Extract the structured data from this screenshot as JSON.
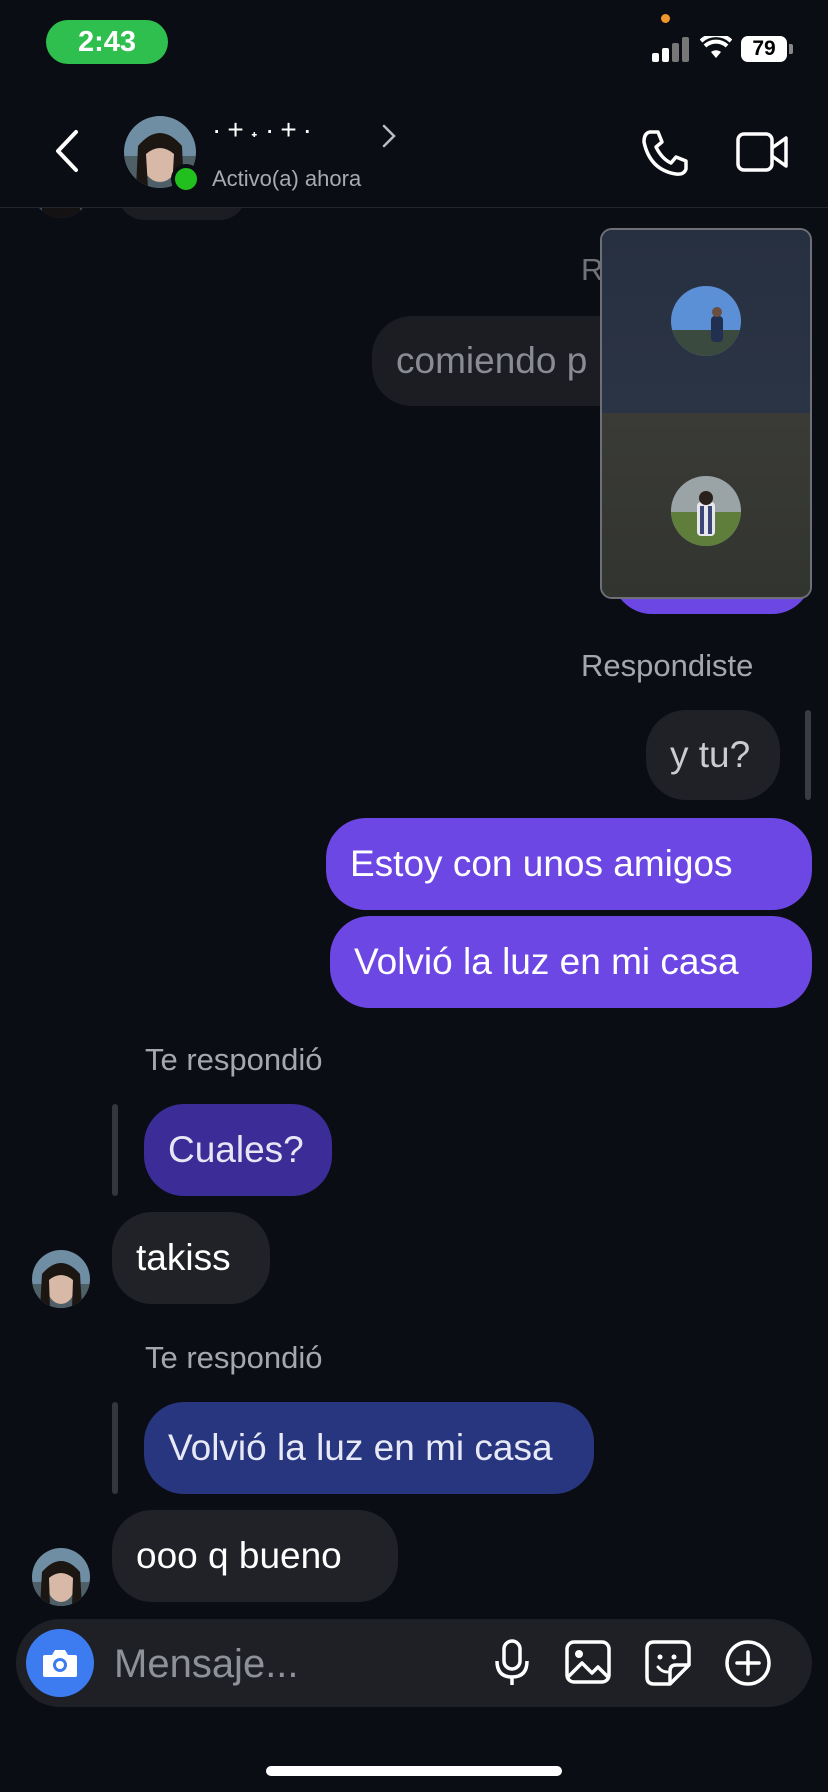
{
  "status_bar": {
    "time": "2:43",
    "battery": "79"
  },
  "header": {
    "contact_name": "·+˖·+·",
    "status": "Activo(a) ahora"
  },
  "messages": {
    "hidden_label": "R",
    "hidden_text": "comiendo p",
    "replied_label": "Respondiste",
    "y_tu": "y tu?",
    "estoy": "Estoy con unos amigos",
    "volvio_sent": "Volvió la luz en mi casa",
    "te_respondio_1": "Te respondió",
    "quote_cuales": "Cuales?",
    "takiss": "takiss",
    "te_respondio_2": "Te respondió",
    "quote_volvio": "Volvió la luz en mi casa",
    "ooo": "ooo q bueno"
  },
  "composer": {
    "placeholder": "Mensaje..."
  },
  "colors": {
    "background": "#0b0d14",
    "sent_bubble": "#6c47e4",
    "received_bubble": "#202228",
    "online": "#22c01e",
    "camera_button": "#3d7cf0"
  }
}
